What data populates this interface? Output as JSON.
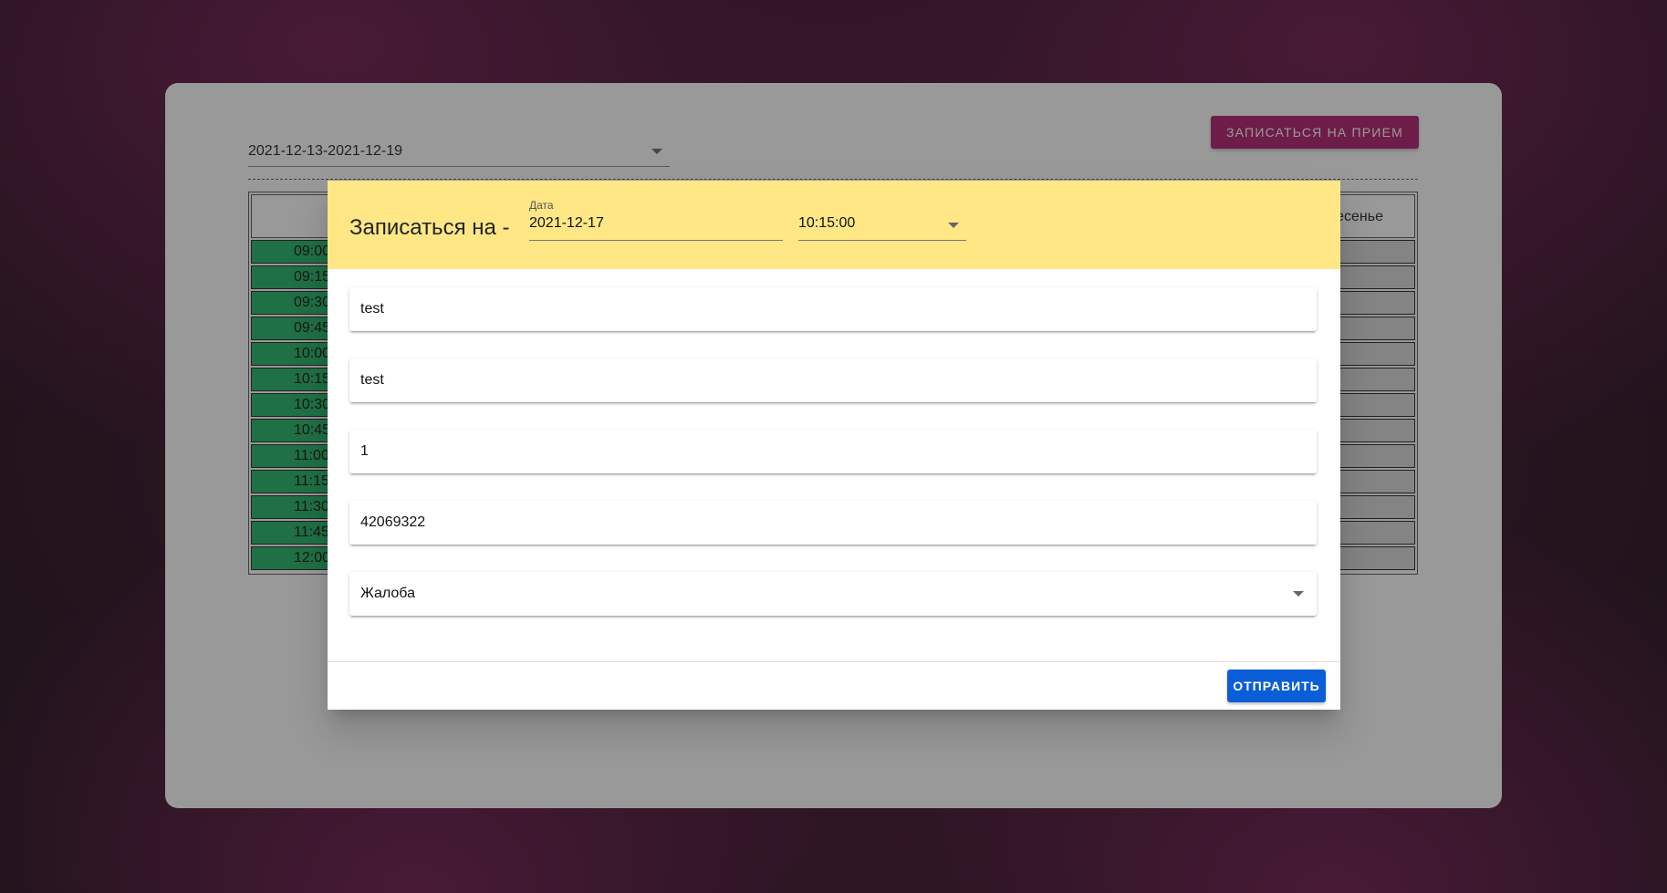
{
  "page": {
    "week_range": "2021-12-13-2021-12-19",
    "book_button_label": "ЗАПИСАТЬСЯ НА ПРИЕМ",
    "schedule_header_sunday": "Воскресенье",
    "times": [
      "09:00",
      "09:15",
      "09:30",
      "09:45",
      "10:00",
      "10:15",
      "10:30",
      "10:45",
      "11:00",
      "11:15",
      "11:30",
      "11:45",
      "12:00"
    ]
  },
  "dialog": {
    "title": "Записаться на -",
    "date_label": "Дата",
    "date_value": "2021-12-17",
    "time_value": "10:15:00",
    "fields": [
      "test",
      "test",
      "1",
      "42069322"
    ],
    "reason": "Жалоба",
    "submit_label": "ОТПРАВИТЬ"
  },
  "colors": {
    "accent": "#b01a6a",
    "slot_free": "#1eb364",
    "dialog_header": "#ffe785",
    "submit": "#0a5ed7"
  }
}
